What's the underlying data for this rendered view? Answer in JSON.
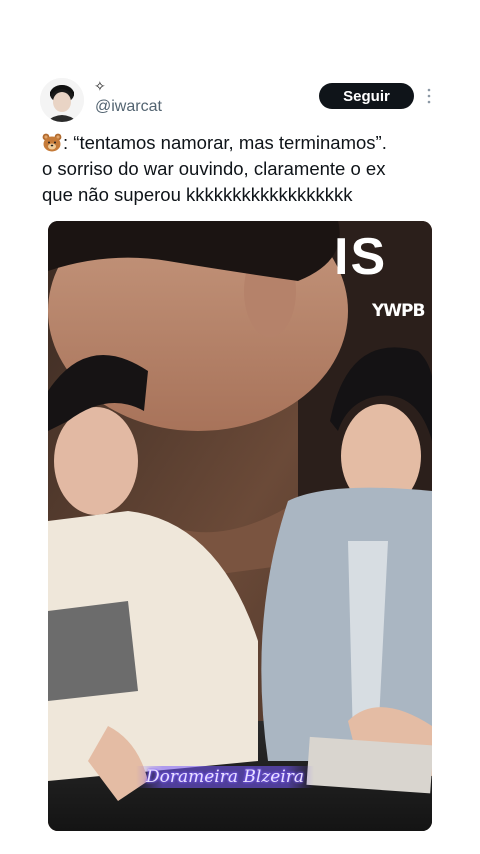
{
  "post": {
    "display_name_badge": "✧",
    "handle": "@iwarcat",
    "follow_label": "Seguir",
    "text_lines": [
      ": “tentamos namorar, mas terminamos”.",
      "o sorriso do war ouvindo, claramente o ex",
      "que não superou kkkkkkkkkkkkkkkkkk"
    ],
    "emoji": "bear-face-emoji"
  },
  "media": {
    "poster_text": "IS",
    "poster_logo": "YWPB",
    "watermark": "Dorameira Blzeira"
  },
  "icons": {
    "more": "more-vertical-icon",
    "sparkle": "sparkle-icon"
  }
}
